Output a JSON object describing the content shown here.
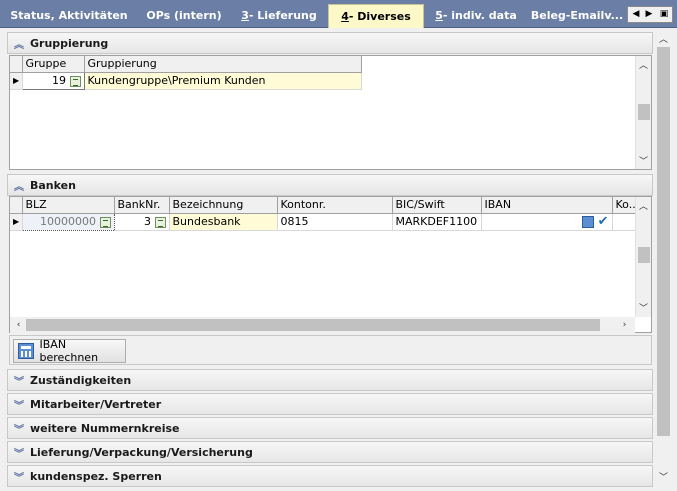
{
  "tabs": [
    {
      "label": "Status, Aktivitäten",
      "active": false
    },
    {
      "label": "OPs (intern)",
      "active": false
    },
    {
      "label": "3 - Lieferung",
      "mnemonic": "3",
      "rest": " - Lieferung",
      "active": false
    },
    {
      "label": "4 - Diverses",
      "mnemonic": "4",
      "rest": " - Diverses",
      "active": true
    },
    {
      "label": "5 - indiv. data",
      "mnemonic": "5",
      "rest": " - indiv. data",
      "active": false
    },
    {
      "label": "Beleg-Emailv...",
      "active": false
    }
  ],
  "tab_nav": {
    "prev": "◀",
    "next": "▶",
    "close": "▣"
  },
  "gruppierung": {
    "title": "Gruppierung",
    "columns": [
      "Gruppe",
      "Gruppierung"
    ],
    "rows": [
      {
        "gruppe": "19",
        "gruppierung": "Kundengruppe\\Premium Kunden"
      }
    ]
  },
  "banken": {
    "title": "Banken",
    "columns": [
      "BLZ",
      "BankNr.",
      "Bezeichnung",
      "Kontonr.",
      "BIC/Swift",
      "IBAN",
      "Ko..."
    ],
    "rows": [
      {
        "blz": "10000000",
        "banknr": "3",
        "bezeichnung": "Bundesbank",
        "kontonr": "0815",
        "bic": "MARKDEF1100",
        "iban": "",
        "ko": ""
      }
    ],
    "button": "IBAN berechnen"
  },
  "collapsed_sections": [
    "Zuständigkeiten",
    "Mitarbeiter/Vertreter",
    "weitere Nummernkreise",
    "Lieferung/Verpackung/Versicherung",
    "kundenspez. Sperren"
  ],
  "colors": {
    "tab_bar": "#6b7fa6",
    "active_tab": "#fdf8c8",
    "cell_yellow": "#fffbd6"
  }
}
